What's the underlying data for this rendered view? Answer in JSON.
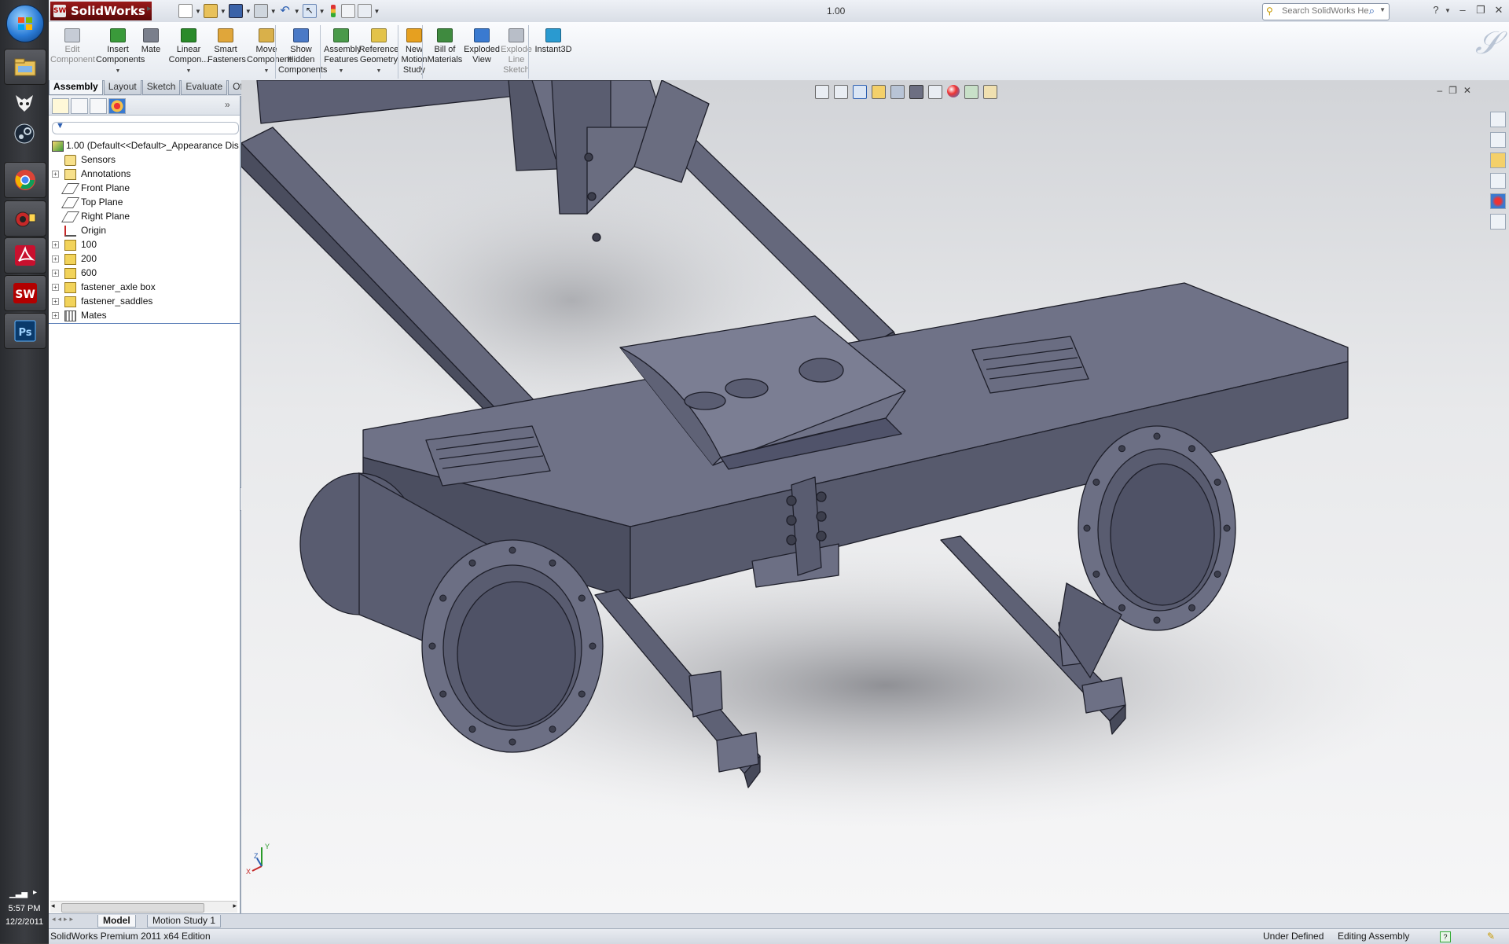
{
  "taskbar": {
    "apps": [
      {
        "name": "explorer-icon"
      },
      {
        "name": "foxit-icon"
      },
      {
        "name": "steam-icon"
      },
      {
        "name": "chrome-icon"
      },
      {
        "name": "network-icon"
      },
      {
        "name": "acrobat-icon"
      },
      {
        "name": "solidworks-icon"
      },
      {
        "name": "photoshop-icon"
      }
    ],
    "clock_time": "5:57 PM",
    "clock_date": "12/2/2011"
  },
  "titlebar": {
    "app_name": "SolidWorks",
    "doc_title": "1.00",
    "search_placeholder": "Search SolidWorks Help",
    "help_label": "?"
  },
  "commands": [
    {
      "label": "Edit\nComponent",
      "enabled": false,
      "icon": "edit-component-icon"
    },
    {
      "label": "Insert\nComponents",
      "enabled": true,
      "icon": "insert-components-icon",
      "dropdown": true
    },
    {
      "label": "Mate",
      "enabled": true,
      "icon": "mate-icon"
    },
    {
      "label": "Linear\nCompon...",
      "enabled": true,
      "icon": "linear-pattern-icon",
      "dropdown": true
    },
    {
      "label": "Smart\nFasteners",
      "enabled": true,
      "icon": "smart-fasteners-icon"
    },
    {
      "label": "Move\nComponent",
      "enabled": true,
      "icon": "move-component-icon",
      "dropdown": true
    },
    {
      "label": "Show\nHidden\nComponents",
      "enabled": true,
      "icon": "show-hidden-icon"
    },
    {
      "label": "Assembly\nFeatures",
      "enabled": true,
      "icon": "assembly-features-icon",
      "dropdown": true
    },
    {
      "label": "Reference\nGeometry",
      "enabled": true,
      "icon": "reference-geometry-icon",
      "dropdown": true
    },
    {
      "label": "New\nMotion\nStudy",
      "enabled": true,
      "icon": "motion-study-icon"
    },
    {
      "label": "Bill of\nMaterials",
      "enabled": true,
      "icon": "bom-icon"
    },
    {
      "label": "Exploded\nView",
      "enabled": true,
      "icon": "exploded-view-icon"
    },
    {
      "label": "Explode\nLine\nSketch",
      "enabled": false,
      "icon": "explode-line-icon"
    },
    {
      "label": "Instant3D",
      "enabled": true,
      "icon": "instant3d-icon"
    }
  ],
  "tabs": [
    "Assembly",
    "Layout",
    "Sketch",
    "Evaluate",
    "Office Products"
  ],
  "active_tab": "Assembly",
  "feature_tree": [
    {
      "label": "1.00  (Default<<Default>_Appearance Dis",
      "icon": "assembly-icon",
      "expander": false,
      "root": true
    },
    {
      "label": "Sensors",
      "icon": "sensor-icon",
      "expander": false
    },
    {
      "label": "Annotations",
      "icon": "annotations-icon",
      "expander": true
    },
    {
      "label": "Front Plane",
      "icon": "plane-icon",
      "expander": false
    },
    {
      "label": "Top Plane",
      "icon": "plane-icon",
      "expander": false
    },
    {
      "label": "Right Plane",
      "icon": "plane-icon",
      "expander": false
    },
    {
      "label": "Origin",
      "icon": "origin-icon",
      "expander": false
    },
    {
      "label": "100",
      "icon": "folder-icon",
      "expander": true
    },
    {
      "label": "200",
      "icon": "folder-icon",
      "expander": true
    },
    {
      "label": "600",
      "icon": "folder-icon",
      "expander": true
    },
    {
      "label": "fastener_axle box",
      "icon": "folder-icon",
      "expander": true
    },
    {
      "label": "fastener_saddles",
      "icon": "folder-icon",
      "expander": true
    },
    {
      "label": "Mates",
      "icon": "mates-icon",
      "expander": true
    }
  ],
  "bottom_tabs": [
    "Model",
    "Motion Study 1"
  ],
  "active_bottom_tab": "Model",
  "status": {
    "edition": "SolidWorks Premium 2011 x64 Edition",
    "definition": "Under Defined",
    "mode": "Editing Assembly"
  },
  "triad": {
    "x": "X",
    "y": "Y",
    "z": "Z"
  },
  "colors": {
    "model": "#5b5e72",
    "model_edge": "#1e1f2a",
    "accent": "#b20000"
  }
}
